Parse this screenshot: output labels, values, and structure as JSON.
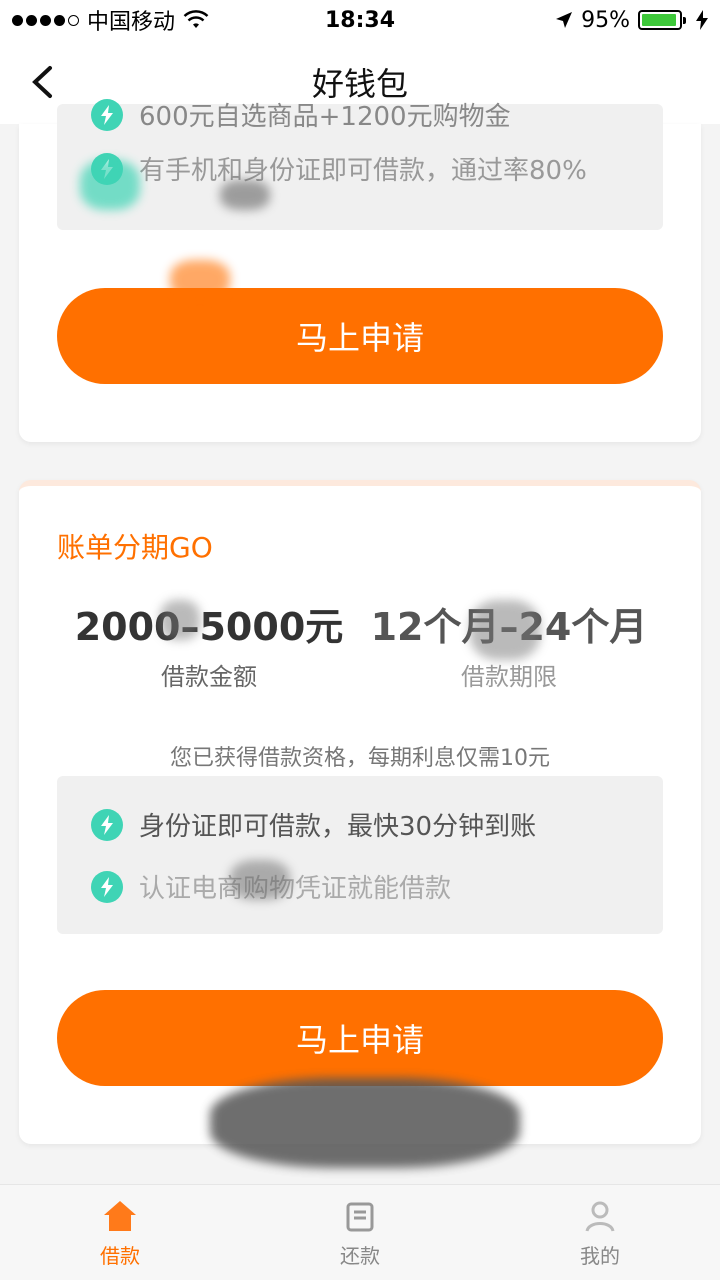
{
  "status_bar": {
    "carrier": "中国移动",
    "time": "18:34",
    "battery": "95%",
    "battery_level": 0.95
  },
  "nav": {
    "title": "好钱包"
  },
  "card_top": {
    "features": [
      "600元自选商品+1200元购物金",
      "有手机和身份证即可借款，通过率80%"
    ],
    "apply_label": "马上申请"
  },
  "card_bottom": {
    "heading": "账单分期GO",
    "amount_value": "2000–5000元",
    "amount_label": "借款金额",
    "term_value": "12个月–24个月",
    "term_label": "借款期限",
    "qualify_note": "您已获得借款资格，每期利息仅需10元",
    "features": [
      "身份证即可借款，最快30分钟到账",
      "认证电商购物凭证就能借款"
    ],
    "apply_label": "马上申请"
  },
  "tabs": [
    {
      "label": "借款",
      "icon": "home-icon"
    },
    {
      "label": "还款",
      "icon": "repay-icon"
    },
    {
      "label": "我的",
      "icon": "profile-icon"
    }
  ],
  "colors": {
    "accent": "#ff7000",
    "feature_icon": "#3fd4b5",
    "battery": "#3ec83a"
  }
}
